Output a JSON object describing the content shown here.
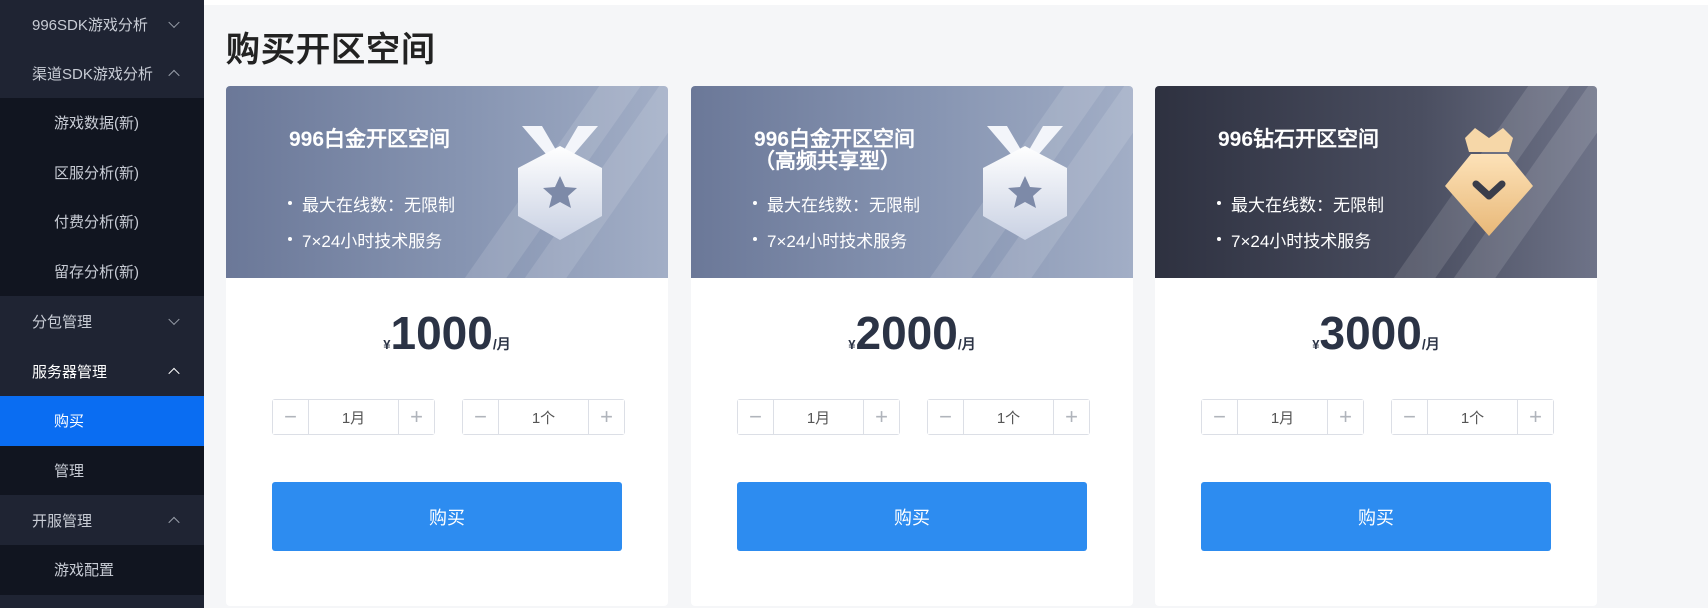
{
  "sidebar": {
    "items": [
      {
        "label": "996SDK游戏分析",
        "state": "collapsed"
      },
      {
        "label": "渠道SDK游戏分析",
        "state": "expanded",
        "children": [
          "游戏数据(新)",
          "区服分析(新)",
          "付费分析(新)",
          "留存分析(新)"
        ]
      },
      {
        "label": "分包管理",
        "state": "collapsed"
      },
      {
        "label": "服务器管理",
        "state": "expanded",
        "children": [
          "购买",
          "管理"
        ],
        "selected_child": "购买"
      },
      {
        "label": "开服管理",
        "state": "expanded",
        "children": [
          "游戏配置"
        ]
      }
    ]
  },
  "page": {
    "title": "购买开区空间"
  },
  "colors": {
    "accent": "#2d8cf0",
    "sidebar_bg": "#1f2433",
    "selected": "#0a6df2"
  },
  "cards": [
    {
      "title": "996白金开区空间",
      "features": [
        "最大在线数：无限制",
        "7×24小时技术服务"
      ],
      "icon": "star-medal-icon",
      "currency": "¥",
      "price": "1000",
      "unit": "/月",
      "duration": "1月",
      "count": "1个",
      "buy_label": "购买"
    },
    {
      "title": "996白金开区空间\n（高频共享型）",
      "features": [
        "最大在线数：无限制",
        "7×24小时技术服务"
      ],
      "icon": "star-medal-icon",
      "currency": "¥",
      "price": "2000",
      "unit": "/月",
      "duration": "1月",
      "count": "1个",
      "buy_label": "购买"
    },
    {
      "title": "996钻石开区空间",
      "features": [
        "最大在线数：无限制",
        "7×24小时技术服务"
      ],
      "icon": "crown-diamond-icon",
      "currency": "¥",
      "price": "3000",
      "unit": "/月",
      "duration": "1月",
      "count": "1个",
      "buy_label": "购买"
    }
  ]
}
